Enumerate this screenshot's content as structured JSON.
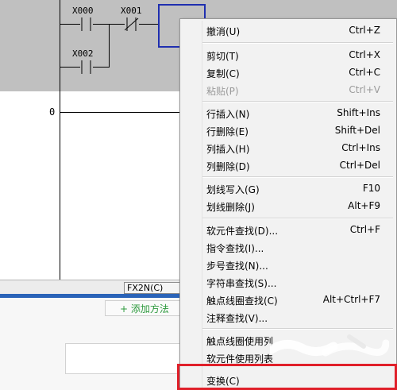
{
  "ladder": {
    "contacts": [
      {
        "label": "X000",
        "type": "NO"
      },
      {
        "label": "X001",
        "type": "NC"
      },
      {
        "label": "X002",
        "type": "NO"
      }
    ],
    "step_number": "0"
  },
  "statusbar": {
    "cpu_type": "FX2N(C)"
  },
  "lower": {
    "add_button_label": "+ 添加方法"
  },
  "context_menu": {
    "groups": [
      [
        {
          "label": "撤消(U)",
          "shortcut": "Ctrl+Z",
          "enabled": true
        }
      ],
      [
        {
          "label": "剪切(T)",
          "shortcut": "Ctrl+X",
          "enabled": true
        },
        {
          "label": "复制(C)",
          "shortcut": "Ctrl+C",
          "enabled": true
        },
        {
          "label": "粘贴(P)",
          "shortcut": "Ctrl+V",
          "enabled": false
        }
      ],
      [
        {
          "label": "行插入(N)",
          "shortcut": "Shift+Ins",
          "enabled": true
        },
        {
          "label": "行删除(E)",
          "shortcut": "Shift+Del",
          "enabled": true
        },
        {
          "label": "列插入(H)",
          "shortcut": "Ctrl+Ins",
          "enabled": true
        },
        {
          "label": "列删除(D)",
          "shortcut": "Ctrl+Del",
          "enabled": true
        }
      ],
      [
        {
          "label": "划线写入(G)",
          "shortcut": "F10",
          "enabled": true
        },
        {
          "label": "划线删除(J)",
          "shortcut": "Alt+F9",
          "enabled": true
        }
      ],
      [
        {
          "label": "软元件查找(D)...",
          "shortcut": "Ctrl+F",
          "enabled": true
        },
        {
          "label": "指令查找(I)...",
          "shortcut": "",
          "enabled": true
        },
        {
          "label": "步号查找(N)...",
          "shortcut": "",
          "enabled": true
        },
        {
          "label": "字符串查找(S)...",
          "shortcut": "",
          "enabled": true
        },
        {
          "label": "触点线圈查找(C)",
          "shortcut": "Alt+Ctrl+F7",
          "enabled": true
        },
        {
          "label": "注释查找(V)...",
          "shortcut": "",
          "enabled": true
        }
      ],
      [
        {
          "label": "触点线圈使用列",
          "shortcut": "",
          "enabled": true
        },
        {
          "label": "软元件使用列表",
          "shortcut": "",
          "enabled": true
        }
      ],
      [
        {
          "label": "变换(C)",
          "shortcut": "",
          "enabled": true
        }
      ]
    ]
  },
  "colors": {
    "highlight": "#e0202a",
    "cursor": "#1f2fb0",
    "ladder_bg": "#c0c0c0",
    "add_button_text": "#2e9a3e"
  }
}
